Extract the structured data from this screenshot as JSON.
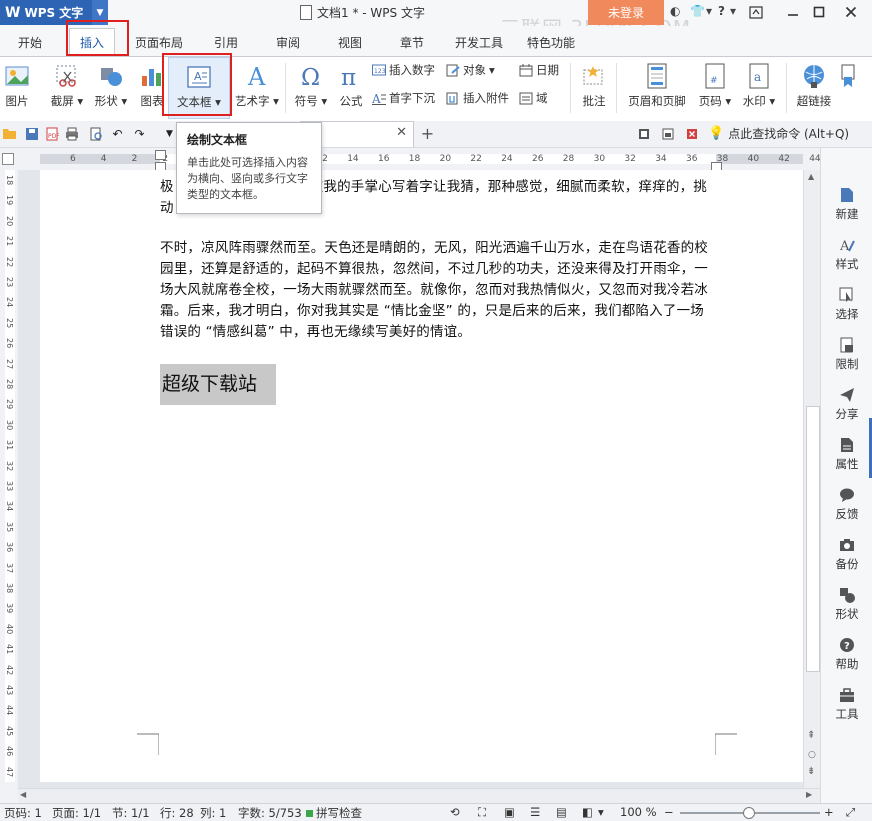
{
  "titlebar": {
    "app_logo": "W",
    "app_name": "WPS 文字",
    "doc_title": "文档1 * - WPS 文字",
    "login_label": "未登录",
    "help_label": "?",
    "watermark": "三联网 3LIAN.COM"
  },
  "tabs": [
    {
      "label": "开始",
      "active": false
    },
    {
      "label": "插入",
      "active": true
    },
    {
      "label": "页面布局",
      "active": false
    },
    {
      "label": "引用",
      "active": false
    },
    {
      "label": "审阅",
      "active": false
    },
    {
      "label": "视图",
      "active": false
    },
    {
      "label": "章节",
      "active": false
    },
    {
      "label": "开发工具",
      "active": false
    },
    {
      "label": "特色功能",
      "active": false
    }
  ],
  "ribbon": {
    "picture": "图片",
    "screenshot": "截屏",
    "shapes": "形状",
    "chart": "图表",
    "textbox": "文本框",
    "wordart": "艺术字",
    "symbol": "符号",
    "formula": "公式",
    "insert_number": "插入数字",
    "object": "对象",
    "date": "日期",
    "drop_cap": "首字下沉",
    "attachment": "插入附件",
    "field": "域",
    "comment": "批注",
    "header_footer": "页眉和页脚",
    "page_number": "页码",
    "watermark": "水印",
    "hyperlink": "超链接"
  },
  "quickbar": {
    "search_command": "点此查找命令 (Alt+Q)"
  },
  "tooltip": {
    "title": "绘制文本框",
    "body": "单击此处可选择插入内容为横向、竖向或多行文字类型的文本框。"
  },
  "ruler": {
    "numbers": [
      "6",
      "4",
      "2",
      "2",
      "4",
      "6",
      "8",
      "10",
      "12",
      "14",
      "16",
      "18",
      "20",
      "22",
      "24",
      "26",
      "28",
      "30",
      "32",
      "34",
      "36",
      "38",
      "40",
      "42",
      "44",
      "46"
    ],
    "vnumbers": [
      "18",
      "19",
      "20",
      "21",
      "22",
      "23",
      "24",
      "25",
      "26",
      "27",
      "28",
      "29",
      "30",
      "31",
      "32",
      "33",
      "34",
      "35",
      "36",
      "37",
      "38",
      "39",
      "40",
      "41",
      "42",
      "43",
      "44",
      "45",
      "46",
      "47"
    ]
  },
  "document": {
    "line1_a": "极",
    "line1_b": "在我的手掌心写着字让我猜，那种感觉，细腻而柔软，痒痒的，挑",
    "line2_a": "动",
    "paragraph2": [
      "不时，凉风阵雨骤然而至。天色还是晴朗的，无风，阳光洒遍千山万水，走在鸟语花香的校",
      "园里，还算是舒适的，起码不算很热，忽然间，不过几秒的功夫，还没来得及打开雨伞，一",
      "场大风就席卷全校，一场大雨就骤然而至。就像你，忽而对我热情似火，又忽而对我冷若冰",
      "霜。后来，我才明白，你对我其实是 “情比金坚” 的，只是后来的后来，我们都陷入了一场",
      "错误的 “情感纠葛” 中，再也无缘续写美好的情谊。"
    ],
    "heading": "超级下载站"
  },
  "sidepanel": [
    {
      "label": "新建"
    },
    {
      "label": "样式"
    },
    {
      "label": "选择"
    },
    {
      "label": "限制"
    },
    {
      "label": "分享"
    },
    {
      "label": "属性"
    },
    {
      "label": "反馈"
    },
    {
      "label": "备份"
    },
    {
      "label": "形状"
    },
    {
      "label": "帮助"
    },
    {
      "label": "工具"
    }
  ],
  "statusbar": {
    "page_code": "页码: 1",
    "page": "页面: 1/1",
    "section": "节: 1/1",
    "row": "行: 28",
    "col": "列: 1",
    "wordcount": "字数: 5/753",
    "spellcheck": "拼写检查",
    "zoom": "100 %"
  },
  "colors": {
    "accent": "#2d64b4",
    "login": "#f08a5d",
    "highlight_box": "#e02020"
  }
}
